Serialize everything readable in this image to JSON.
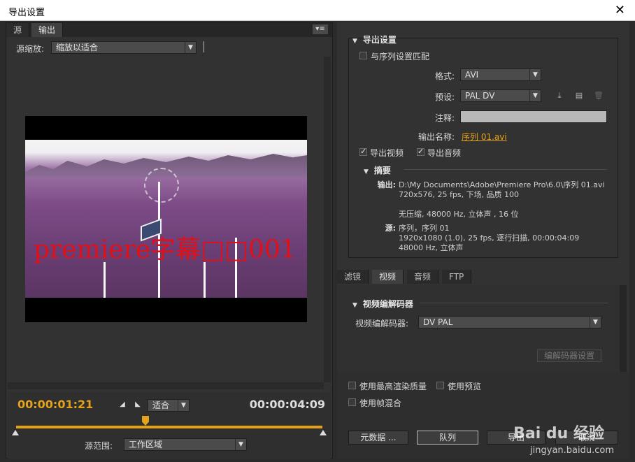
{
  "window": {
    "title": "导出设置",
    "close_glyph": "✕"
  },
  "left": {
    "tabs": [
      {
        "label": "源"
      },
      {
        "label": "输出"
      }
    ],
    "panel_menu_glyph": "▾≡",
    "source_scale": {
      "label": "源缩放:",
      "value": "缩放以适合"
    },
    "watermark_text": "premiere字幕□□001",
    "timeline": {
      "current": "00:00:01:21",
      "duration": "00:00:04:09",
      "fit_value": "适合",
      "source_range_label": "源范围:",
      "source_range_value": "工作区域"
    }
  },
  "export": {
    "header": "导出设置",
    "match_sequence": {
      "label": "与序列设置匹配",
      "checked": false
    },
    "format": {
      "label": "格式:",
      "value": "AVI"
    },
    "preset": {
      "label": "预设:",
      "value": "PAL DV"
    },
    "comments": {
      "label": "注释:",
      "value": ""
    },
    "output_name": {
      "label": "输出名称:",
      "value": "序列 01.avi"
    },
    "export_video": {
      "label": "导出视频",
      "checked": true
    },
    "export_audio": {
      "label": "导出音频",
      "checked": true
    },
    "summary": {
      "header": "摘要",
      "output_label": "输出:",
      "output_lines": [
        "D:\\My Documents\\Adobe\\Premiere Pro\\6.0\\序列 01.avi",
        "720x576, 25 fps, 下场, 品质  100",
        "无压缩, 48000 Hz, 立体声 , 16 位"
      ],
      "source_label": "源:",
      "source_lines": [
        "序列，序列 01",
        "1920x1080 (1.0), 25 fps, 逐行扫描, 00:00:04:09",
        "48000 Hz, 立体声"
      ]
    }
  },
  "settings_tabs": [
    {
      "label": "滤镜"
    },
    {
      "label": "视频"
    },
    {
      "label": "音频"
    },
    {
      "label": "FTP"
    }
  ],
  "codec": {
    "header": "视频编解码器",
    "label": "视频编解码器:",
    "value": "DV PAL",
    "settings_button": "编解码器设置"
  },
  "options": {
    "max_render": "使用最高渲染质量",
    "use_previews": "使用预览",
    "frame_blend": "使用帧混合"
  },
  "buttons": {
    "metadata": "元数据 ...",
    "queue": "队列",
    "export": "导出",
    "cancel": "取消"
  },
  "watermark": {
    "brand": "Bai du 经验",
    "url": "jingyan.baidu.com"
  },
  "colors": {
    "accent": "#e3a21a",
    "panel": "#323232"
  }
}
